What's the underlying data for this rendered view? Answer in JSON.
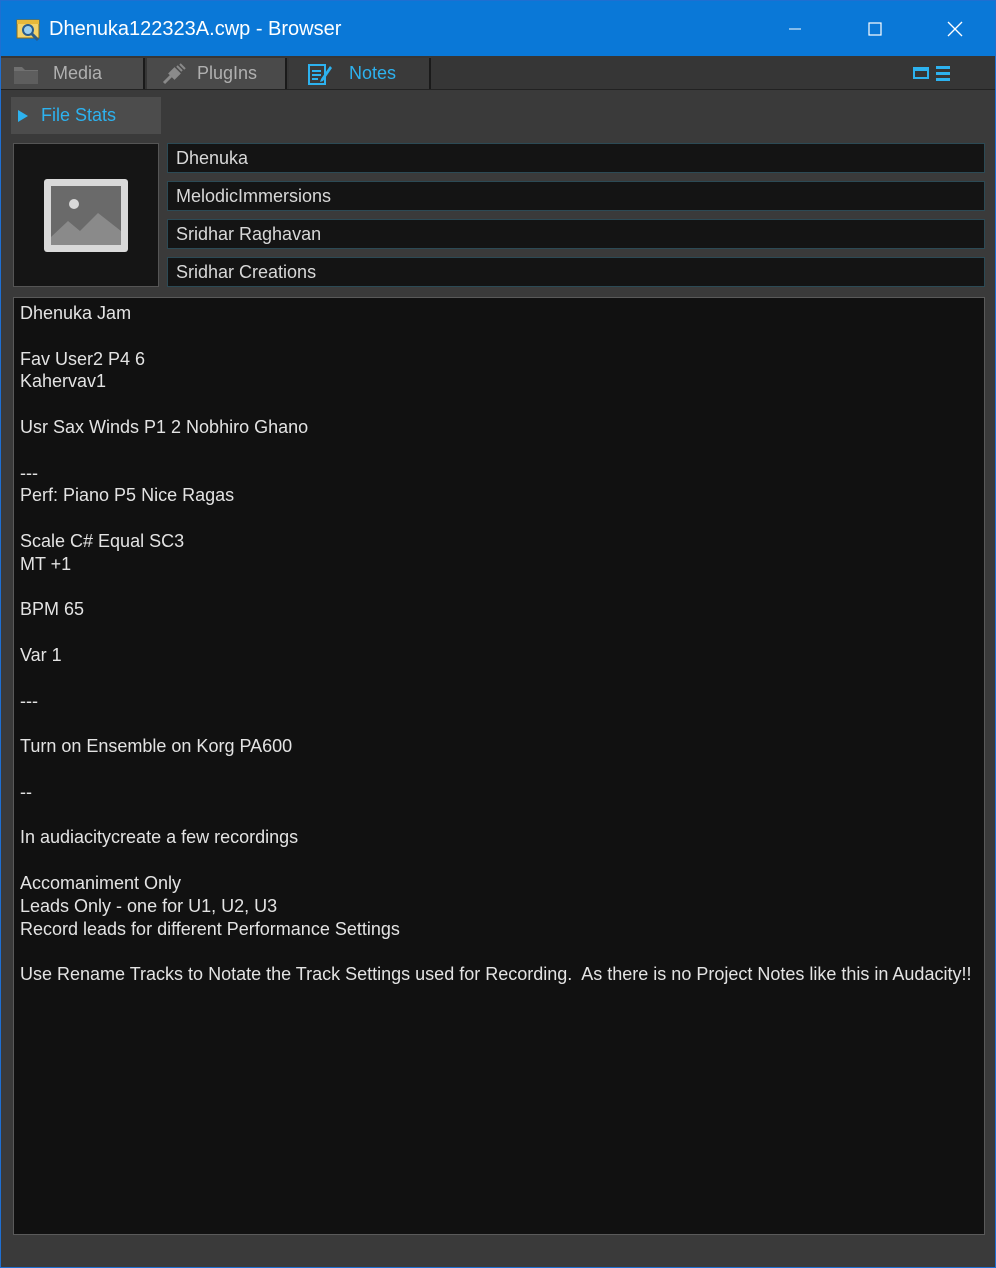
{
  "window": {
    "title": "Dhenuka122323A.cwp - Browser",
    "icon": "browser-app-icon",
    "controls": [
      "minimize-icon",
      "maximize-icon",
      "close-icon"
    ]
  },
  "tabs": [
    {
      "label": "Media",
      "icon": "folder-icon",
      "active": false
    },
    {
      "label": "PlugIns",
      "icon": "plug-icon",
      "active": false
    },
    {
      "label": "Notes",
      "icon": "notepad-icon",
      "active": true
    }
  ],
  "layout_buttons": [
    "dock-icon",
    "menu-icon"
  ],
  "file_stats": {
    "label": "File Stats",
    "icon": "expand-triangle-icon"
  },
  "thumbnail": {
    "icon": "image-placeholder-icon"
  },
  "fields": {
    "title": "Dhenuka",
    "album": "MelodicImmersions",
    "artist": "Sridhar Raghavan",
    "publisher": "Sridhar Creations"
  },
  "notes": {
    "lines": [
      "Dhenuka Jam",
      "",
      "Fav User2 P4 6",
      "Kahervav1",
      "",
      "Usr Sax Winds P1 2 Nobhiro Ghano",
      "",
      "---",
      "Perf: Piano P5 Nice Ragas",
      "",
      "Scale C# Equal SC3",
      "MT +1",
      "",
      "BPM 65",
      "",
      "Var 1",
      "",
      "---",
      "",
      "Turn on Ensemble on Korg PA600",
      "",
      "--",
      "",
      "In audiacitycreate a few recordings",
      "",
      "Accomaniment Only",
      "Leads Only - one for U1, U2, U3",
      "Record leads for different Performance Settings",
      "",
      "Use Rename Tracks to Notate the Track Settings used for Recording.  As there is no Project Notes like this in Audacity!!"
    ]
  },
  "colors": {
    "titlebar": "#0a78d7",
    "accent": "#2db2ef",
    "panel": "#3a3a3a",
    "notes_bg": "#111111"
  }
}
